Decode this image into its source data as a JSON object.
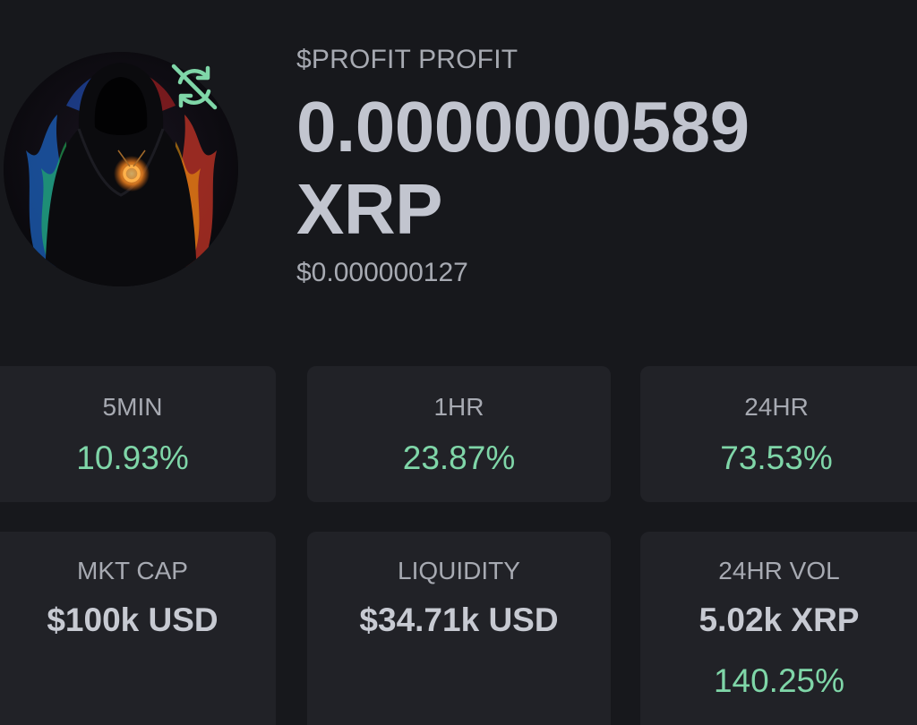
{
  "token": {
    "name": "$PROFIT PROFIT",
    "price": "0.0000000589 XRP",
    "price_usd": "$0.000000127",
    "avatar_icon": "hooded-figure-avatar",
    "badge_icon": "swap-off-icon"
  },
  "changes": [
    {
      "label": "5MIN",
      "value": "10.93%"
    },
    {
      "label": "1HR",
      "value": "23.87%"
    },
    {
      "label": "24HR",
      "value": "73.53%"
    }
  ],
  "stats": {
    "market_cap": {
      "label": "MKT CAP",
      "value": "$100k USD"
    },
    "liquidity": {
      "label": "LIQUIDITY",
      "value": "$34.71k USD"
    },
    "volume": {
      "label": "24HR VOL",
      "value": "5.02k XRP",
      "change": "140.25%"
    }
  },
  "colors": {
    "background": "#17181c",
    "card": "#212227",
    "positive": "#7fd6a8",
    "text_primary": "#c2c5cf",
    "text_secondary": "#a7aab2"
  }
}
